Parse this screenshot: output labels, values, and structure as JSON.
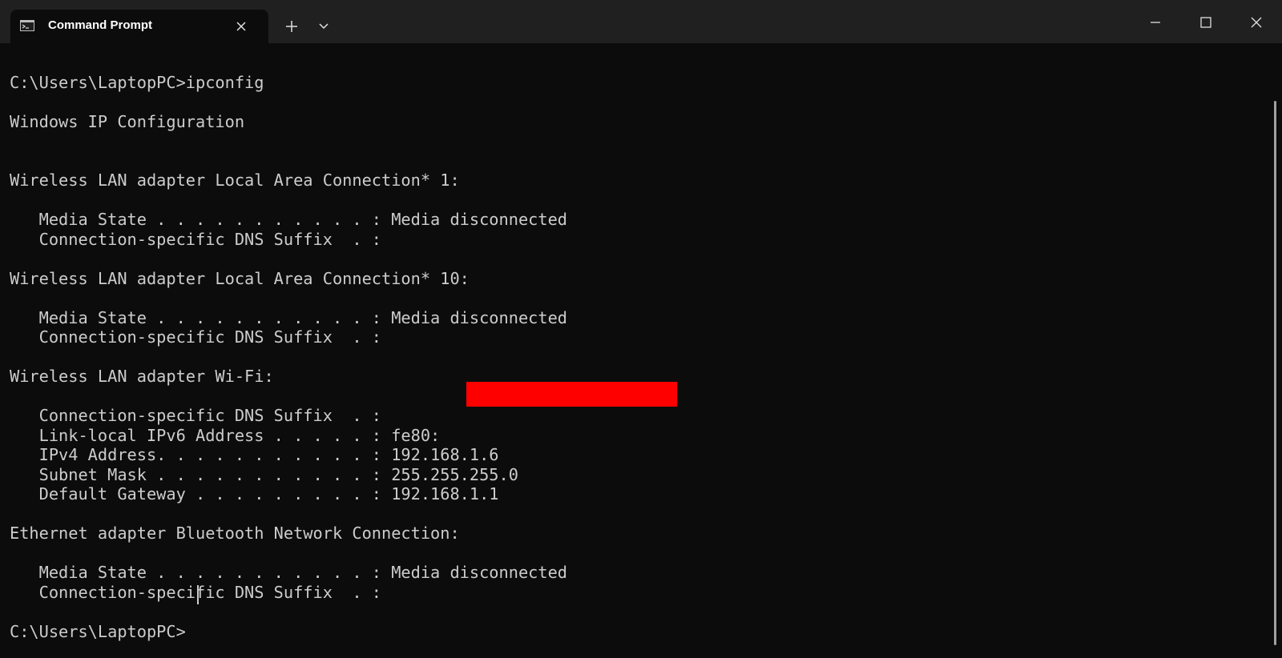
{
  "window": {
    "tab_title": "Command Prompt",
    "tab_icon": "cmd-icon",
    "buttons": {
      "close_tab": "close-icon",
      "new_tab": "plus-icon",
      "tab_dropdown": "chevron-down-icon",
      "minimize": "minimize-icon",
      "maximize": "maximize-icon",
      "close": "close-icon"
    },
    "colors": {
      "background": "#0c0c0c",
      "titlebar": "#202020",
      "text": "#cccccc",
      "redaction": "#ff0000"
    }
  },
  "terminal": {
    "lines": [
      "C:\\Users\\LaptopPC>ipconfig",
      "",
      "Windows IP Configuration",
      "",
      "",
      "Wireless LAN adapter Local Area Connection* 1:",
      "",
      "   Media State . . . . . . . . . . . : Media disconnected",
      "   Connection-specific DNS Suffix  . :",
      "",
      "Wireless LAN adapter Local Area Connection* 10:",
      "",
      "   Media State . . . . . . . . . . . : Media disconnected",
      "   Connection-specific DNS Suffix  . :",
      "",
      "Wireless LAN adapter Wi-Fi:",
      "",
      "   Connection-specific DNS Suffix  . :",
      "   Link-local IPv6 Address . . . . . : fe80:",
      "   IPv4 Address. . . . . . . . . . . : 192.168.1.6",
      "   Subnet Mask . . . . . . . . . . . : 255.255.255.0",
      "   Default Gateway . . . . . . . . . : 192.168.1.1",
      "",
      "Ethernet adapter Bluetooth Network Connection:",
      "",
      "   Media State . . . . . . . . . . . : Media disconnected",
      "   Connection-specific DNS Suffix  . :",
      "",
      "C:\\Users\\LaptopPC>"
    ]
  }
}
